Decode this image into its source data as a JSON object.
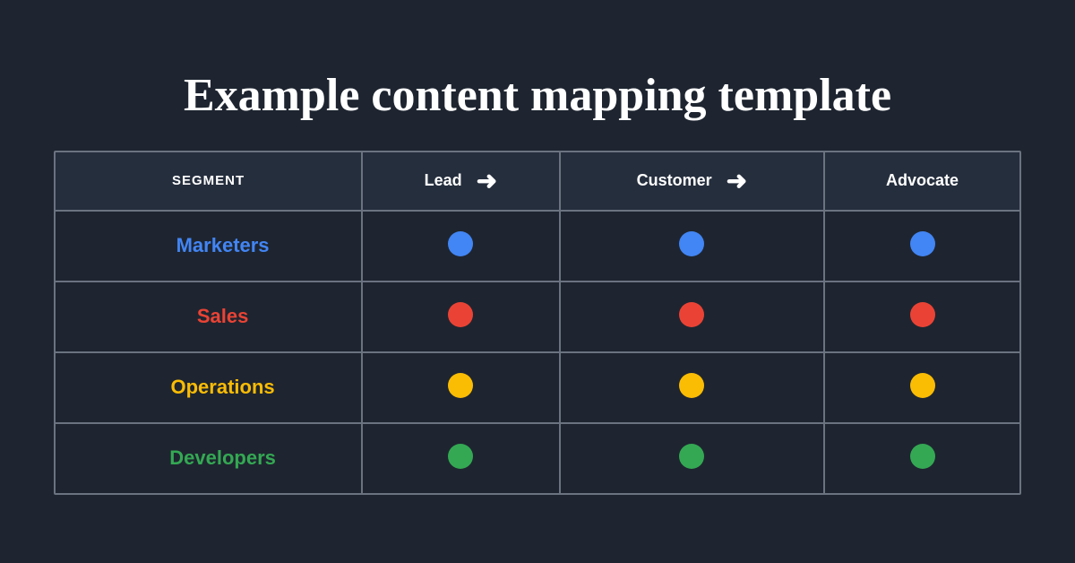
{
  "title": "Example content mapping template",
  "table": {
    "headers": {
      "segment": "SEGMENT",
      "lead": "Lead",
      "customer": "Customer",
      "advocate": "Advocate"
    },
    "rows": [
      {
        "segment": "Marketers",
        "segment_class": "marketers",
        "dot_class": "dot-blue"
      },
      {
        "segment": "Sales",
        "segment_class": "sales",
        "dot_class": "dot-red"
      },
      {
        "segment": "Operations",
        "segment_class": "operations",
        "dot_class": "dot-yellow"
      },
      {
        "segment": "Developers",
        "segment_class": "developers",
        "dot_class": "dot-green"
      }
    ],
    "arrow": "⟶"
  }
}
